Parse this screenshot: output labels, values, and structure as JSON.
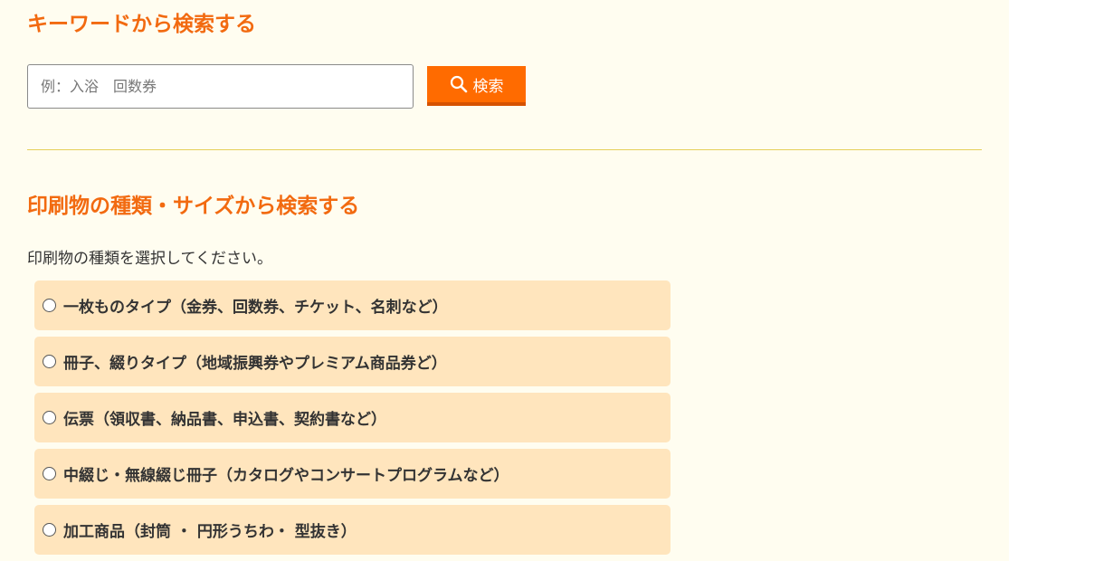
{
  "keyword_section": {
    "title": "キーワードから検索する",
    "search_placeholder": "例：入浴　回数券",
    "search_value": "",
    "search_button_label": "検索",
    "search_icon": "search-icon"
  },
  "type_section": {
    "title": "印刷物の種類・サイズから検索する",
    "instruction": "印刷物の種類を選択してください。",
    "options": [
      {
        "label": "一枚ものタイプ（金券、回数券、チケット、名刺など）",
        "selected": false
      },
      {
        "label": "冊子、綴りタイプ（地域振興券やプレミアム商品券ど）",
        "selected": false
      },
      {
        "label": "伝票（領収書、納品書、申込書、契約書など）",
        "selected": false
      },
      {
        "label": "中綴じ・無線綴じ冊子（カタログやコンサートプログラムなど）",
        "selected": false
      },
      {
        "label": "加工商品（封筒 ・ 円形うちわ・ 型抜き）",
        "selected": false
      }
    ]
  },
  "colors": {
    "accent": "#f26a10",
    "button": "#ff6b00",
    "panel_background": "#fffdf0",
    "option_background": "#ffe5bd",
    "divider": "#e6cf58"
  }
}
